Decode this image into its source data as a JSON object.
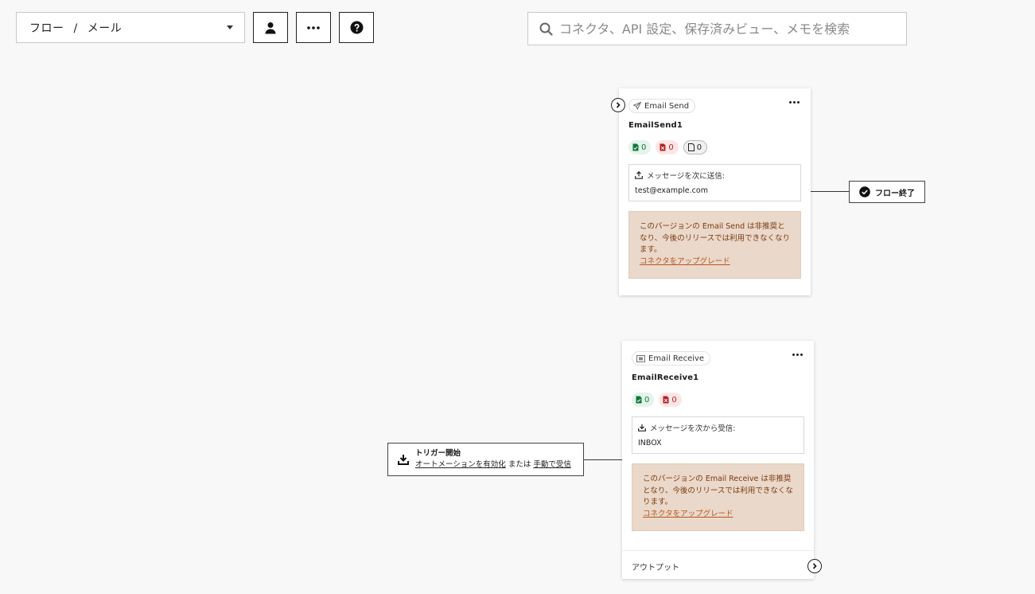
{
  "toolbar": {
    "breadcrumb_root": "フロー",
    "breadcrumb_separator": "/",
    "breadcrumb_current": "メール",
    "search_placeholder": "コネクタ、API 設定、保存済みビュー、メモを検索"
  },
  "cards": [
    {
      "type_label": "Email Send",
      "name": "EmailSend1",
      "counters": {
        "success": "0",
        "error": "0",
        "total": "0"
      },
      "message_label": "メッセージを次に送信:",
      "message_value": "test@example.com",
      "warning_text": "このバージョンの Email Send は非推奨となり、今後のリリースでは利用できなくなります。",
      "upgrade_link": "コネクタをアップグレード"
    },
    {
      "type_label": "Email Receive",
      "name": "EmailReceive1",
      "counters": {
        "success": "0",
        "error": "0"
      },
      "message_label": "メッセージを次から受信:",
      "message_value": "INBOX",
      "warning_text": "このバージョンの Email Receive は非推奨となり、今後のリリースでは利用できなくなります。",
      "upgrade_link": "コネクタをアップグレード",
      "footer_label": "アウトプット"
    }
  ],
  "trigger": {
    "title": "トリガー開始",
    "enable_link": "オートメーションを有効化",
    "or_text": "または",
    "manual_link": "手動で受信"
  },
  "end_node": {
    "label": "フロー終了"
  },
  "icons": [
    "caret-down-icon",
    "user-icon",
    "ellipsis-icon",
    "help-icon",
    "search-icon",
    "send-icon",
    "mail-icon",
    "file-icon",
    "upload-icon",
    "download-icon",
    "check-circle-icon",
    "chevron-right-icon"
  ],
  "colors": {
    "accent_warning_bg": "#ead8ca",
    "warning_link": "#b5581f",
    "success": "#0f7a3a",
    "error": "#b42323"
  }
}
